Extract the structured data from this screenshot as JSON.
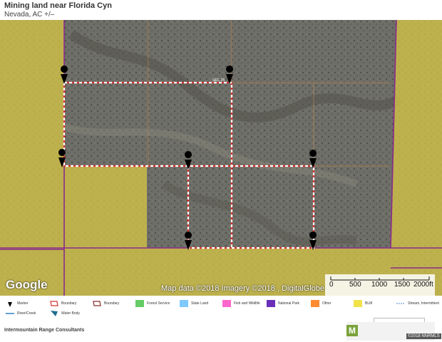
{
  "header": {
    "title": "Mining land near Florida Cyn",
    "subtitle": "Nevada,  AC +/–"
  },
  "map": {
    "google_logo": "Google",
    "attribution": "Map data ©2018  Imagery ©2018 , DigitalGlobe",
    "scale": {
      "labels": [
        "0",
        "500",
        "1000",
        "1500",
        "2000ft"
      ]
    },
    "parcel_label": "SEC 25",
    "colors": {
      "blm_overlay": "#e0d24a",
      "boundary_line": "#8a2a8a",
      "parcel_dash": "#ffffff",
      "parcel_line": "#d8332e",
      "marker": "#000000",
      "terrain": "#6e6e68"
    }
  },
  "legend": {
    "items": [
      {
        "icon": "marker-icon",
        "label": "Marker",
        "color": "#000000"
      },
      {
        "icon": "boundary-icon",
        "label": "Boundary",
        "color": "#d8332e"
      },
      {
        "icon": "boundary-icon",
        "label": "Boundary",
        "color": "#8a2a2a"
      },
      {
        "icon": "forest-service-icon",
        "label": "Forest Service",
        "color": "#66cc66"
      },
      {
        "icon": "state-land-icon",
        "label": "State Land",
        "color": "#7fc9ff"
      },
      {
        "icon": "fish-wildlife-icon",
        "label": "Fish and Wildlife",
        "color": "#ff66cc"
      },
      {
        "icon": "national-park-icon",
        "label": "National Park",
        "color": "#6a2fb8"
      },
      {
        "icon": "other-icon",
        "label": "Other",
        "color": "#ff8c33"
      },
      {
        "icon": "blm-icon",
        "label": "BLM",
        "color": "#f2e24a"
      },
      {
        "icon": "stream-icon",
        "label": "Stream, Intermittent",
        "color": "#4a8fd8"
      },
      {
        "icon": "river-icon",
        "label": "River/Creek",
        "color": "#2f7fc8"
      },
      {
        "icon": "water-body-icon",
        "label": "Water Body",
        "color": "#1f6f8f"
      }
    ]
  },
  "footer": {
    "company": "Intermountain Range  Consultants",
    "logo_letter": "M",
    "badge": "©2018 NNRMLS"
  }
}
